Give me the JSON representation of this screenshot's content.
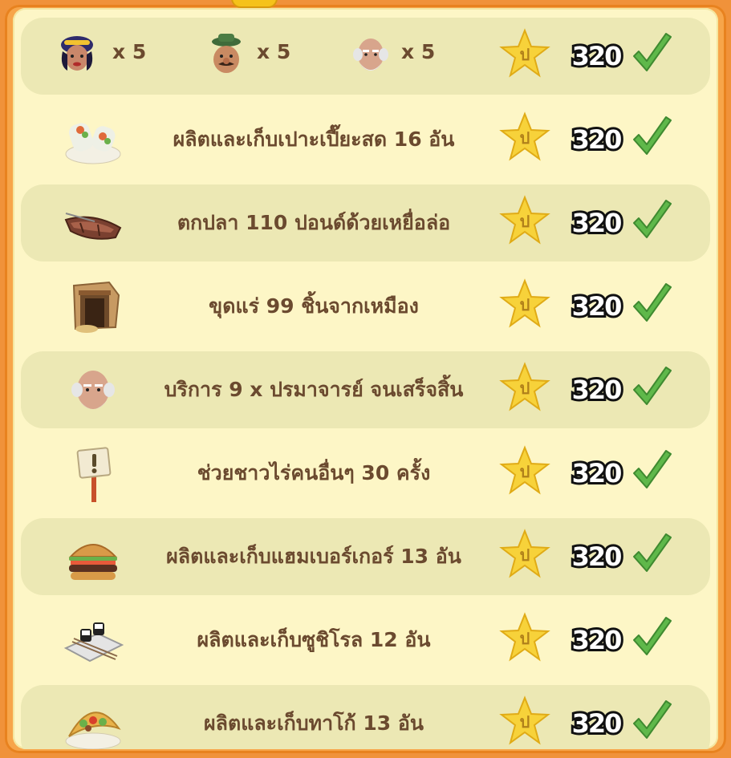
{
  "reward_value": "320",
  "people_row": {
    "items": [
      {
        "icon": "woman-avatar-icon",
        "count": "x 5"
      },
      {
        "icon": "farmer-avatar-icon",
        "count": "x 5"
      },
      {
        "icon": "professor-avatar-icon",
        "count": "x 5"
      }
    ]
  },
  "tasks": [
    {
      "icon": "spring-roll-icon",
      "text": "ผลิตและเก็บเปาะเปี๊ยะสด 16 อัน"
    },
    {
      "icon": "rowboat-icon",
      "text": "ตกปลา 110 ปอนด์ด้วยเหยื่อล่อ"
    },
    {
      "icon": "mine-icon",
      "text": "ขุดแร่ 99 ชิ้นจากเหมือง"
    },
    {
      "icon": "professor-avatar-icon",
      "text": "บริการ 9 x ปรมาจารย์ จนเสร็จสิ้น"
    },
    {
      "icon": "help-sign-icon",
      "text": "ช่วยชาวไร่คนอื่นๆ 30 ครั้ง"
    },
    {
      "icon": "hamburger-icon",
      "text": "ผลิตและเก็บแฮมเบอร์เกอร์ 13 อัน"
    },
    {
      "icon": "sushi-roll-icon",
      "text": "ผลิตและเก็บซูชิโรล 12 อัน"
    },
    {
      "icon": "taco-icon",
      "text": "ผลิตและเก็บทาโก้ 13 อัน"
    }
  ],
  "colors": {
    "frame": "#f0923a",
    "panel": "#fdf6c6",
    "row_shade": "#ece8b4",
    "text": "#6b4a2f",
    "check": "#5fb84a",
    "star": "#f7d23a"
  }
}
